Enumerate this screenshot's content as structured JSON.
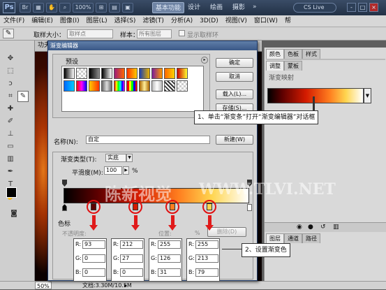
{
  "app": {
    "logo": "Ps",
    "zoom_label": "100%",
    "workspaces": [
      "基本功能",
      "设计",
      "绘画",
      "摄影"
    ],
    "search_label": "CS Live",
    "window_controls": [
      "-",
      "□",
      "×"
    ]
  },
  "menu": [
    "文件(F)",
    "编辑(E)",
    "图像(I)",
    "图层(L)",
    "选择(S)",
    "滤镜(T)",
    "分析(A)",
    "3D(D)",
    "视图(V)",
    "窗口(W)",
    "帮"
  ],
  "options": {
    "sample_size_label": "取样大小：",
    "sample_size_value": "取样点",
    "sample_label": "样本：",
    "sample_value": "所有图层",
    "show_ring_label": "显示取样环"
  },
  "doc_tab": "功夫",
  "status": {
    "zoom": "50%",
    "doc": "文档:3.30M/10.5M"
  },
  "panels": {
    "tabs1": [
      "颜色",
      "色板",
      "样式"
    ],
    "tabs2": [
      "调整",
      "蒙板"
    ],
    "adjust_title": "渐变映射",
    "bottom_tabs": [
      "图层",
      "通道",
      "路径"
    ]
  },
  "dialog": {
    "title": "渐变编辑器",
    "presets_label": "预设",
    "ok": "确定",
    "cancel": "取消",
    "load": "载入(L)...",
    "save": "存储(S)...",
    "name_label": "名称(N):",
    "name_value": "自定",
    "new": "新建(W)",
    "gradient_type_label": "渐变类型(T):",
    "gradient_type_value": "实底",
    "smoothness_label": "平滑度(M):",
    "smoothness_value": "100",
    "percent": "%",
    "stops_label": "色标",
    "opacity_label": "不透明度:",
    "location_label": "位置:",
    "delete_label": "删除(D)",
    "rgb": [
      {
        "r": "93",
        "g": "0",
        "b": "0",
        "color": "#5d0000"
      },
      {
        "r": "212",
        "g": "27",
        "b": "0",
        "color": "#d41b00"
      },
      {
        "r": "255",
        "g": "126",
        "b": "31",
        "color": "#ff7e1f"
      },
      {
        "r": "255",
        "g": "213",
        "b": "79",
        "color": "#ffd54f"
      }
    ],
    "rgb_labels": {
      "r": "R:",
      "g": "G:",
      "b": "B:"
    }
  },
  "annotations": {
    "step1": "1、单击“渐变条”打开“渐变编辑器”对话框",
    "step2": "2、设置渐变色",
    "watermark": "WWW.TLVI.NET",
    "watermark_cn": "陈新视觉"
  }
}
